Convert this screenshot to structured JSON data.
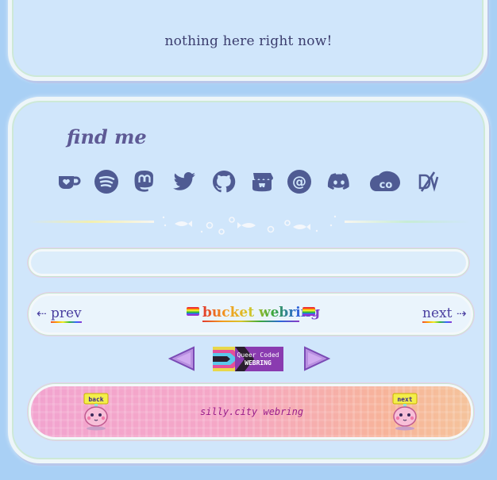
{
  "status": {
    "empty_message": "nothing here right now!"
  },
  "social": {
    "heading": "find me",
    "links": [
      {
        "name": "ko-fi",
        "icon": "ko-fi-icon"
      },
      {
        "name": "spotify",
        "icon": "spotify-icon"
      },
      {
        "name": "mastodon",
        "icon": "mastodon-icon"
      },
      {
        "name": "twitter",
        "icon": "twitter-icon"
      },
      {
        "name": "github",
        "icon": "github-icon"
      },
      {
        "name": "itch.io",
        "icon": "itchio-icon"
      },
      {
        "name": "email",
        "icon": "at-sign-icon"
      },
      {
        "name": "discord",
        "icon": "discord-icon"
      },
      {
        "name": "cohost",
        "icon": "cohost-icon"
      },
      {
        "name": "dreamwidth",
        "icon": "dreamwidth-icon"
      }
    ]
  },
  "webring_bucket": {
    "prev_arrow": "⇠",
    "prev_label": "prev",
    "title": "bucket webring",
    "next_label": "next",
    "next_arrow": "⇢"
  },
  "webring_queer": {
    "badge_line1": "Queer Coded",
    "badge_line2": "WEBRING"
  },
  "webring_silly": {
    "title": "silly.city webring",
    "back_label": "back",
    "next_label": "next"
  },
  "colors": {
    "background": "#a9d0f5",
    "card": "#d0e6fb",
    "icon": "#4f5b93",
    "link": "#4a3fa0"
  }
}
